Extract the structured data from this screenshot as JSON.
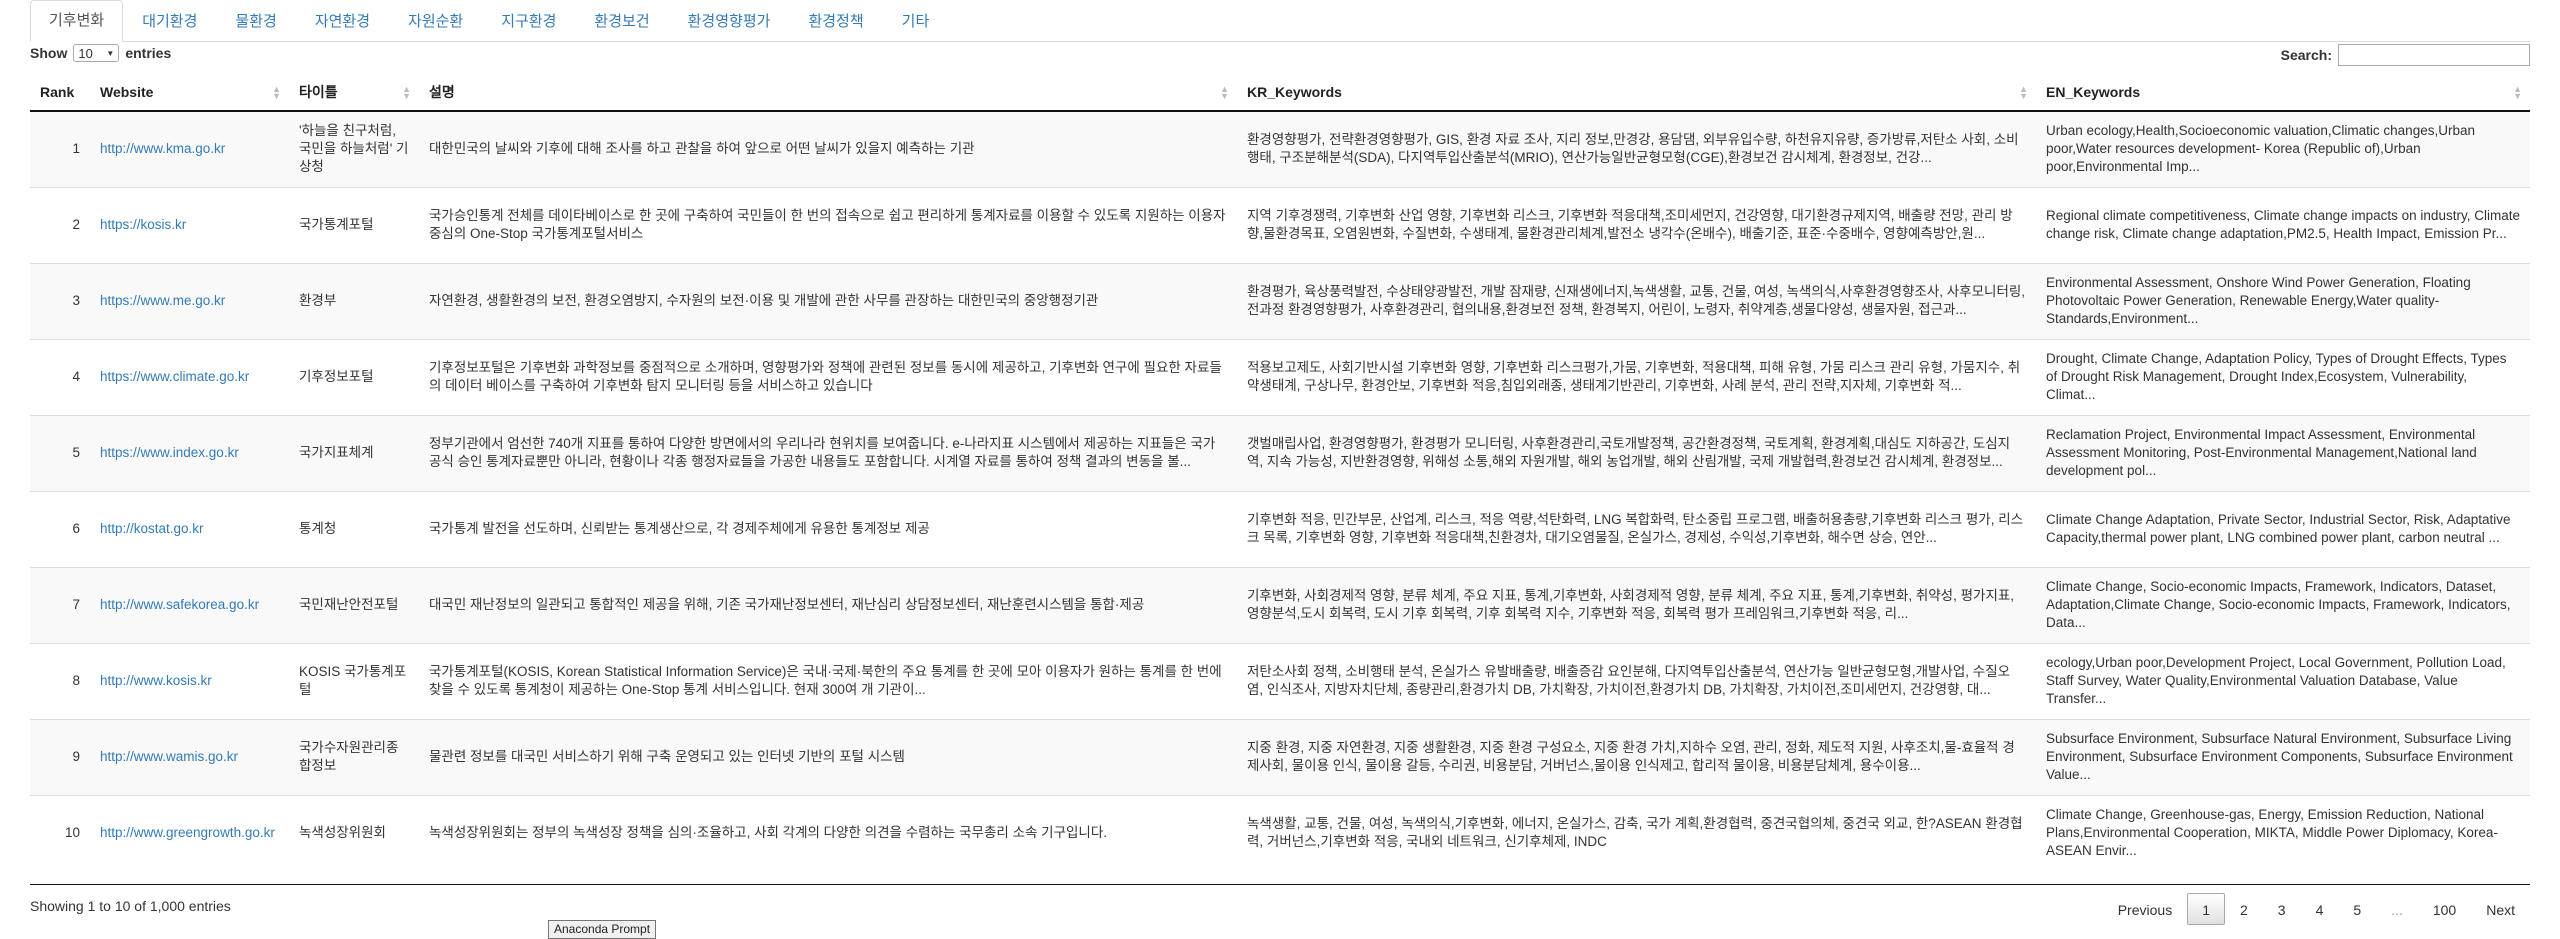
{
  "tabs": [
    "기후변화",
    "대기환경",
    "물환경",
    "자연환경",
    "자원순환",
    "지구환경",
    "환경보건",
    "환경영향평가",
    "환경정책",
    "기타"
  ],
  "controls": {
    "show_label": "Show",
    "entries_value": "10",
    "entries_label": "entries",
    "search_label": "Search:",
    "search_value": ""
  },
  "table": {
    "headers": [
      "Rank",
      "Website",
      "타이틀",
      "설명",
      "KR_Keywords",
      "EN_Keywords"
    ],
    "rows": [
      {
        "rank": "1",
        "website": "http://www.kma.go.kr",
        "title": "'하늘을 친구처럼, 국민을 하늘처럼' 기상청",
        "desc": "대한민국의 날씨와 기후에 대해 조사를 하고 관찰을 하여 앞으로 어떤 날씨가 있을지 예측하는 기관",
        "kr": "환경영향평가, 전략환경영향평가, GIS, 환경 자료 조사, 지리 정보,만경강, 용담댐, 외부유입수량, 하천유지유량, 증가방류,저탄소 사회, 소비행태, 구조분해분석(SDA), 다지역투입산출분석(MRIO), 연산가능일반균형모형(CGE),환경보건 감시체계, 환경정보, 건강...",
        "en": "Urban ecology,Health,Socioeconomic valuation,Climatic changes,Urban poor,Water resources development- Korea (Republic of),Urban poor,Environmental Imp..."
      },
      {
        "rank": "2",
        "website": "https://kosis.kr",
        "title": "국가통계포털",
        "desc": "국가승인통계 전체를 데이타베이스로 한 곳에 구축하여 국민들이 한 번의 접속으로 쉽고 편리하게 통계자료를 이용할 수 있도록 지원하는 이용자 중심의 One-Stop 국가통계포털서비스",
        "kr": "지역 기후경쟁력, 기후변화 산업 영향, 기후변화 리스크, 기후변화 적응대책,조미세먼지, 건강영향, 대기환경규제지역, 배출량 전망, 관리 방향,물환경목표, 오염원변화, 수질변화, 수생태계, 물환경관리체계,발전소 냉각수(온배수), 배출기준, 표준·수중배수, 영향예측방안,원...",
        "en": "Regional climate competitiveness, Climate change impacts on industry, Climate change risk, Climate change adaptation,PM2.5, Health Impact, Emission Pr..."
      },
      {
        "rank": "3",
        "website": "https://www.me.go.kr",
        "title": "환경부",
        "desc": "자연환경, 생활환경의 보전, 환경오염방지, 수자원의 보전·이용 및 개발에 관한 사무를 관장하는 대한민국의 중앙행정기관",
        "kr": "환경평가, 육상풍력발전, 수상태양광발전, 개발 잠재량, 신재생에너지,녹색생활, 교통, 건물, 여성, 녹색의식,사후환경영향조사, 사후모니터링, 전과정 환경영향평가, 사후환경관리, 협의내용,환경보전 정책, 환경복지, 어린이, 노령자, 취약계층,생물다양성, 생물자원, 접근과...",
        "en": "Environmental Assessment, Onshore Wind Power Generation, Floating Photovoltaic Power Generation, Renewable Energy,Water quality-Standards,Environment..."
      },
      {
        "rank": "4",
        "website": "https://www.climate.go.kr",
        "title": "기후정보포털",
        "desc": "기후정보포털은 기후변화 과학정보를 중점적으로 소개하며, 영향평가와 정책에 관련된 정보를 동시에 제공하고, 기후변화 연구에 필요한 자료들의 데이터 베이스를 구축하여 기후변화 탐지 모니터링 등을 서비스하고 있습니다",
        "kr": "적용보고제도, 사회기반시설 기후변화 영향, 기후변화 리스크평가,가뭄, 기후변화, 적용대책, 피해 유형, 가뭄 리스크 관리 유형, 가뭄지수, 취약생태계, 구상나무, 환경안보, 기후변화 적응,침입외래종, 생태계기반관리, 기후변화, 사례 분석, 관리 전략,지자체, 기후변화 적...",
        "en": "Drought, Climate Change, Adaptation Policy, Types of Drought Effects, Types of Drought Risk Management, Drought Index,Ecosystem, Vulnerability, Climat..."
      },
      {
        "rank": "5",
        "website": "https://www.index.go.kr",
        "title": "국가지표체계",
        "desc": "정부기관에서 엄선한 740개 지표를 통하여 다양한 방면에서의 우리나라 현위치를 보여줍니다. e-나라지표 시스템에서 제공하는 지표들은 국가 공식 승인 통계자료뿐만 아니라, 현황이나 각종 행정자료들을 가공한 내용들도 포함합니다. 시계열 자료를 통하여 정책 결과의 변동을 볼...",
        "kr": "갯벌매립사업, 환경영향평가, 환경평가 모니터링, 사후환경관리,국토개발정책, 공간환경정책, 국토계획, 환경계획,대심도 지하공간, 도심지역, 지속 가능성, 지반환경영향, 위해성 소통,해외 자원개발, 해외 농업개발, 해외 산림개발, 국제 개발협력,환경보건 감시체계, 환경정보...",
        "en": "Reclamation Project, Environmental Impact Assessment, Environmental Assessment Monitoring, Post-Environmental Management,National land development pol..."
      },
      {
        "rank": "6",
        "website": "http://kostat.go.kr",
        "title": "통계청",
        "desc": "국가통계 발전을 선도하며, 신뢰받는 통계생산으로, 각 경제주체에게 유용한 통계정보 제공",
        "kr": "기후변화 적응, 민간부문, 산업계, 리스크, 적응 역량,석탄화력, LNG 복합화력, 탄소중립 프로그램, 배출허용총량,기후변화 리스크 평가, 리스크 목록, 기후변화 영향, 기후변화 적응대책,친환경차, 대기오염물질, 온실가스, 경제성, 수익성,기후변화, 해수면 상승, 연안...",
        "en": "Climate Change Adaptation, Private Sector, Industrial Sector, Risk, Adaptative Capacity,thermal power plant, LNG combined power plant, carbon neutral ..."
      },
      {
        "rank": "7",
        "website": "http://www.safekorea.go.kr",
        "title": "국민재난안전포털",
        "desc": "대국민 재난정보의 일관되고 통합적인 제공을 위해, 기존 국가재난정보센터, 재난심리 상담정보센터, 재난훈련시스템을 통합·제공",
        "kr": "기후변화, 사회경제적 영향, 분류 체계, 주요 지표, 통계,기후변화, 사회경제적 영향, 분류 체계, 주요 지표, 통계,기후변화, 취약성, 평가지표, 영향분석,도시 회복력, 도시 기후 회복력, 기후 회복력 지수, 기후변화 적응, 회복력 평가 프레임워크,기후변화 적응, 리...",
        "en": "Climate Change, Socio-economic Impacts, Framework, Indicators, Dataset, Adaptation,Climate Change, Socio-economic Impacts, Framework, Indicators, Data..."
      },
      {
        "rank": "8",
        "website": "http://www.kosis.kr",
        "title": "KOSIS 국가통계포털",
        "desc": "국가통계포털(KOSIS, Korean Statistical Information Service)은 국내·국제·북한의 주요 통계를 한 곳에 모아 이용자가 원하는 통계를 한 번에 찾을 수 있도록 통계청이 제공하는 One-Stop 통계 서비스입니다. 현재 300여 개 기관이...",
        "kr": "저탄소사회 정책, 소비행태 분석, 온실가스 유발배출량, 배출증감 요인분해, 다지역투입산출분석, 연산가능 일반균형모형,개발사업, 수질오염, 인식조사, 지방자치단체, 종량관리,환경가치 DB, 가치확장, 가치이전,환경가치 DB, 가치확장, 가치이전,조미세먼지, 건강영향, 대...",
        "en": "ecology,Urban poor,Development Project, Local Government, Pollution Load, Staff Survey, Water Quality,Environmental Valuation Database, Value Transfer..."
      },
      {
        "rank": "9",
        "website": "http://www.wamis.go.kr",
        "title": "국가수자원관리종합정보",
        "desc": "물관련 정보를 대국민 서비스하기 위해 구축 운영되고 있는 인터넷 기반의 포털 시스템",
        "kr": "지중 환경, 지중 자연환경, 지중 생활환경, 지중 환경 구성요소, 지중 환경 가치,지하수 오염, 관리, 정화, 제도적 지원, 사후조치,물-효율적 경제사회, 물이용 인식, 물이용 갈등, 수리권, 비용분담, 거버넌스,물이용 인식제고, 합리적 물이용, 비용분담체계, 용수이용...",
        "en": "Subsurface Environment, Subsurface Natural Environment, Subsurface Living Environment, Subsurface Environment Components, Subsurface Environment Value..."
      },
      {
        "rank": "10",
        "website": "http://www.greengrowth.go.kr",
        "title": "녹색성장위원회",
        "desc": "녹색성장위원회는 정부의 녹색성장 정책을 심의·조율하고, 사회 각계의 다양한 의견을 수렴하는 국무총리 소속 기구입니다.",
        "kr": "녹색생활, 교통, 건물, 여성, 녹색의식,기후변화, 에너지, 온실가스, 감축, 국가 계획,환경협력, 중견국협의체, 중견국 외교, 한?ASEAN 환경협력, 거버넌스,기후변화 적응, 국내외 네트워크, 신기후체제, INDC",
        "en": "Climate Change, Greenhouse-gas, Energy, Emission Reduction, National Plans,Environmental Cooperation, MIKTA, Middle Power Diplomacy, Korea-ASEAN Envir..."
      }
    ]
  },
  "footer": {
    "info": "Showing 1 to 10 of 1,000 entries",
    "pager": [
      "Previous",
      "1",
      "2",
      "3",
      "4",
      "5",
      "...",
      "100",
      "Next"
    ],
    "current_page": "1"
  },
  "tooltip": "Anaconda Prompt"
}
